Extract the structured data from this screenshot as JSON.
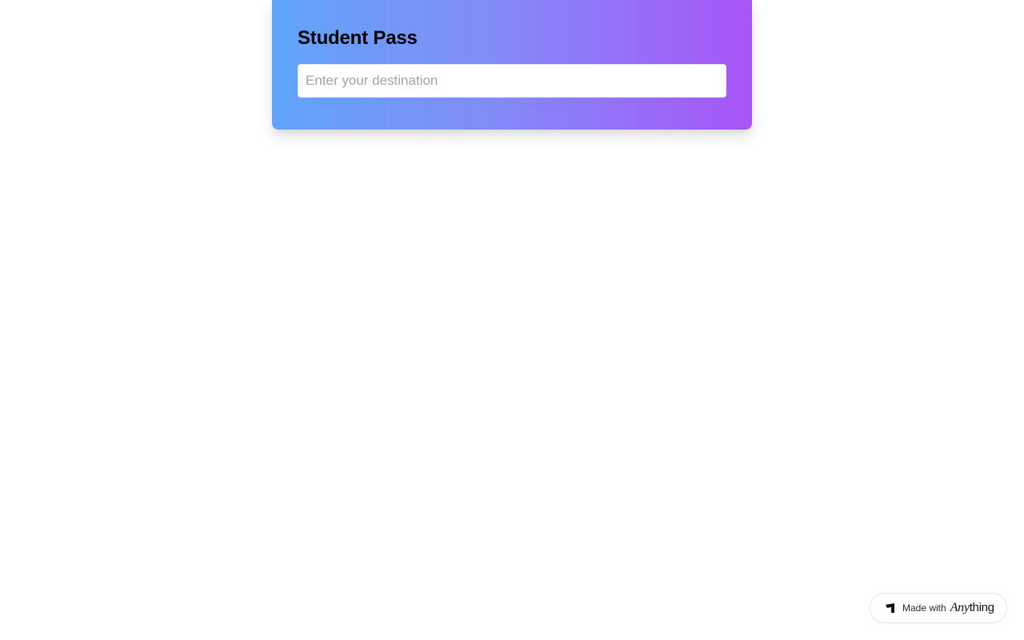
{
  "student_pass": {
    "title": "Student Pass",
    "destination": {
      "value": "",
      "placeholder": "Enter your destination"
    },
    "gradient": {
      "start": "#60a5fa",
      "end": "#a855f7"
    }
  },
  "badge": {
    "prefix": "Made with",
    "brand_part1": "Any",
    "brand_part2": "thing",
    "icon": "anything-logo-icon"
  }
}
